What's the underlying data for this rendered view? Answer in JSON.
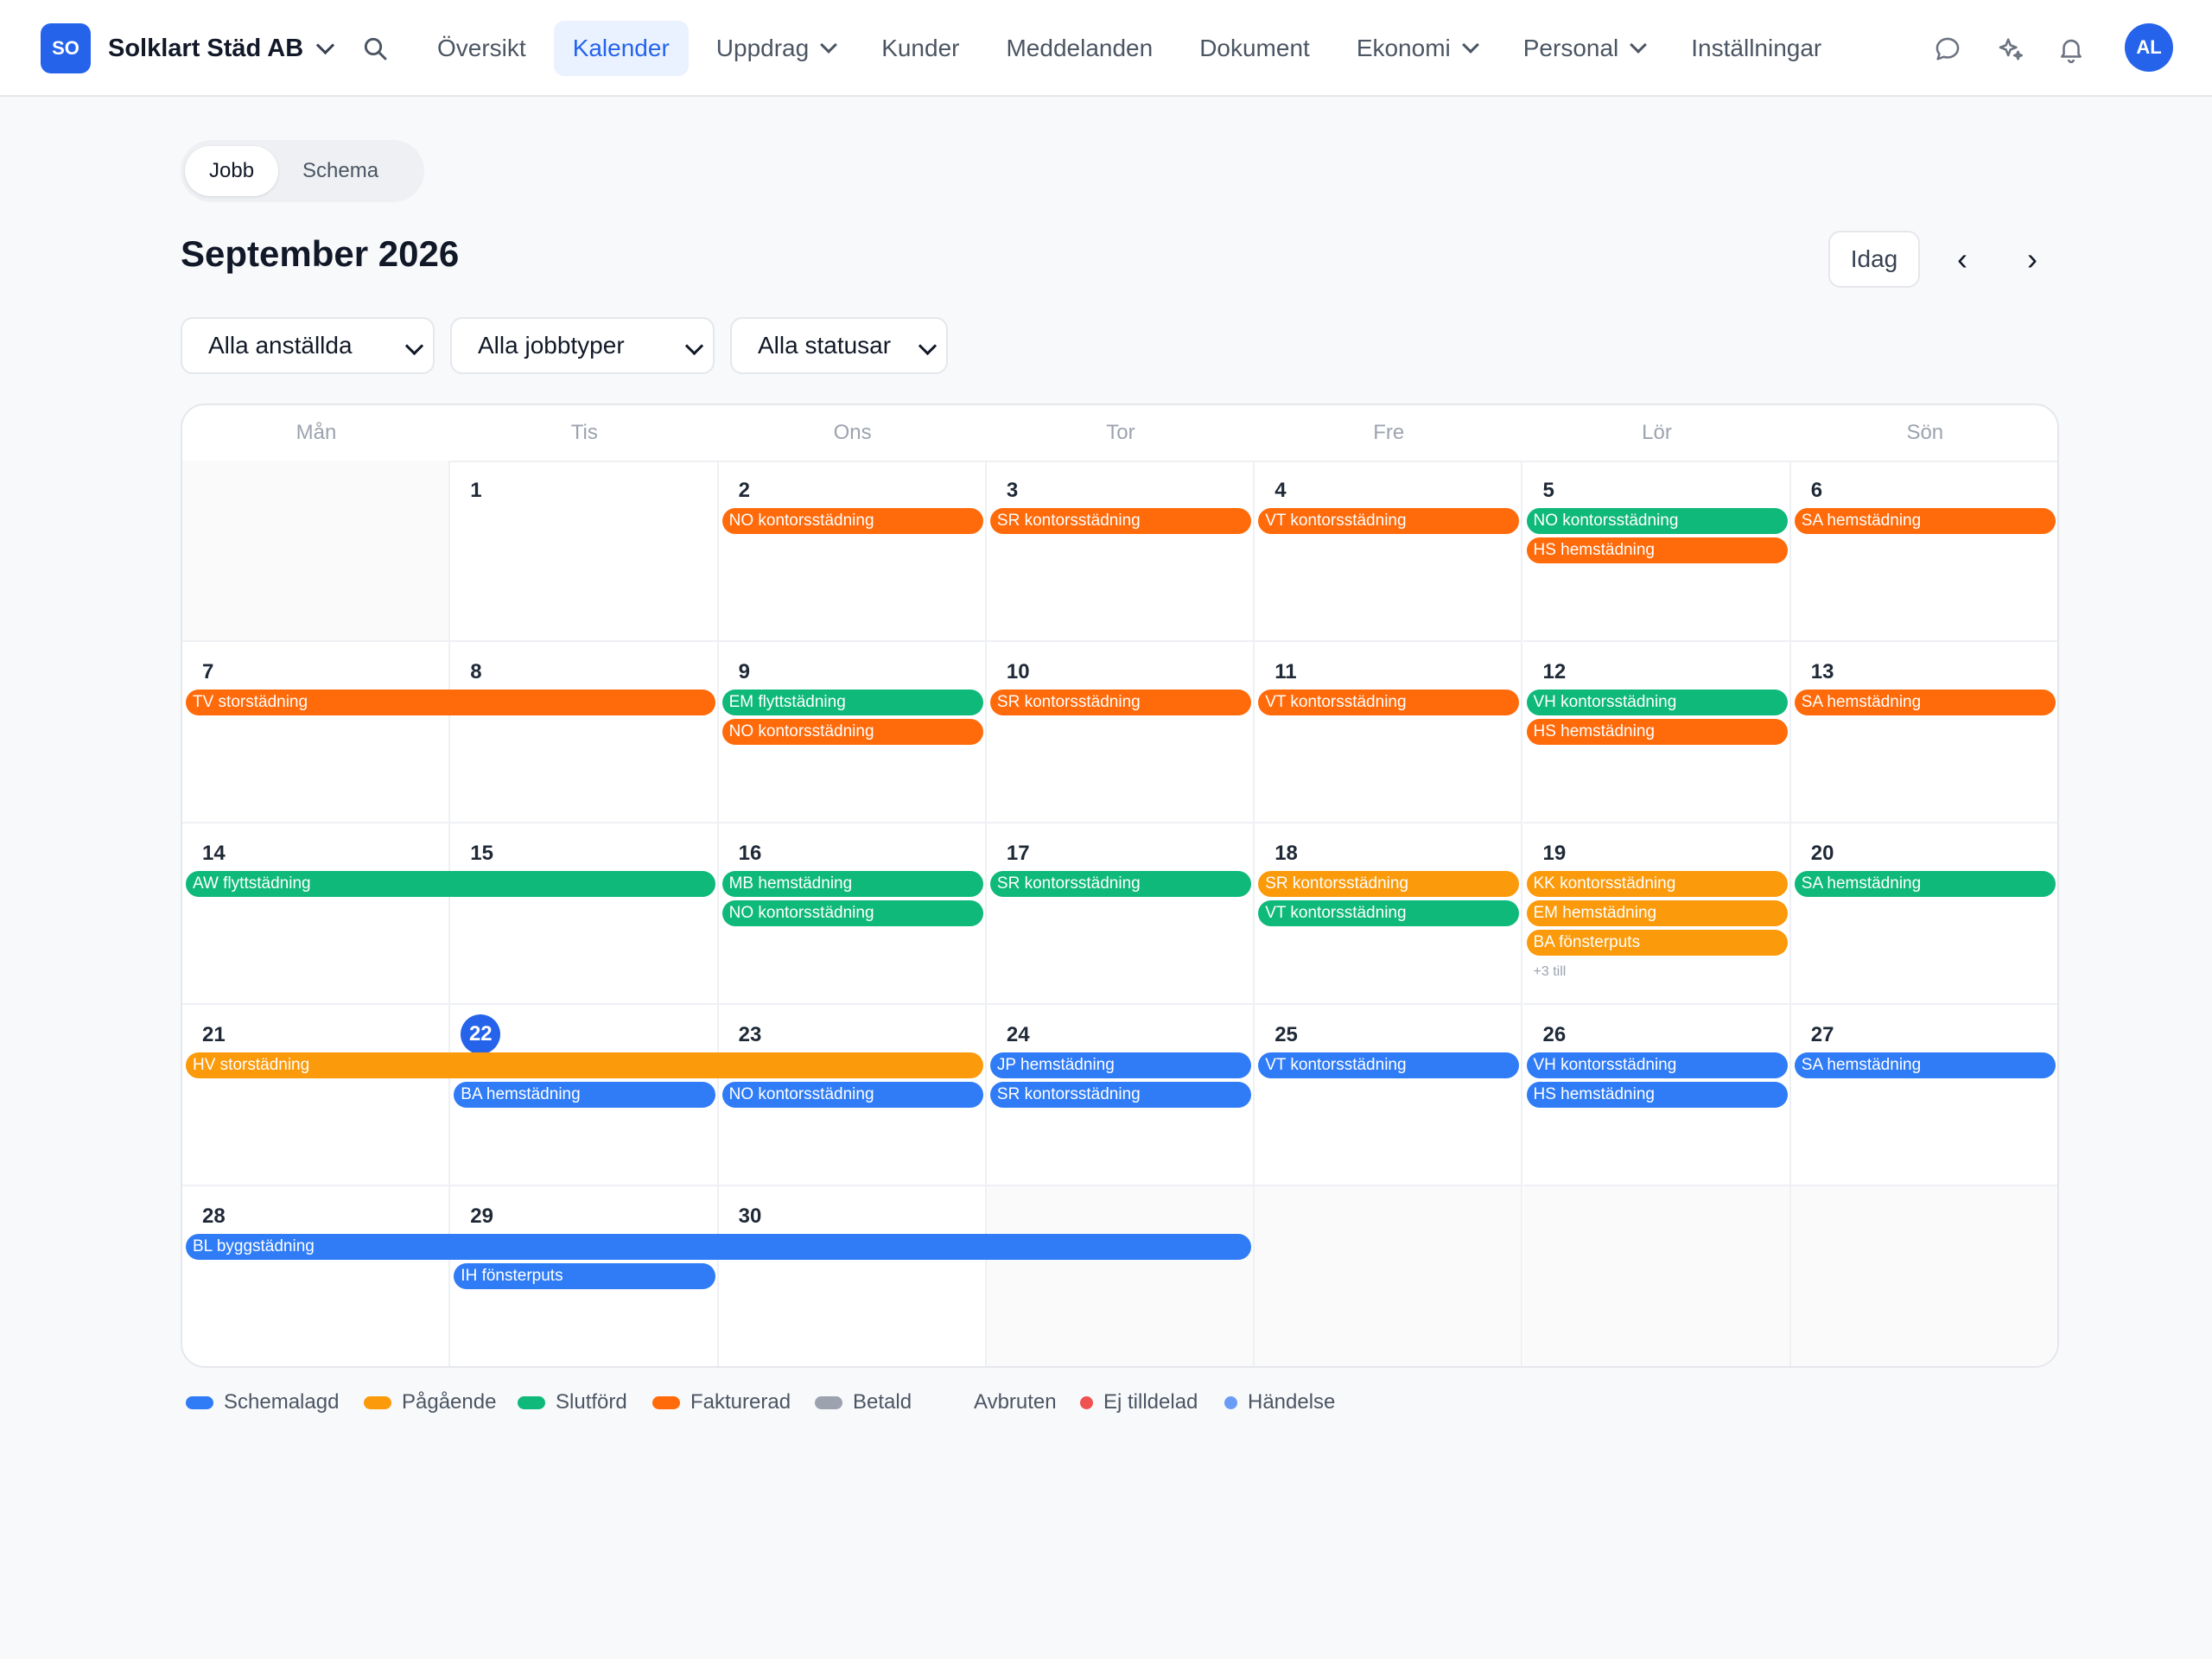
{
  "org": {
    "initials": "SO",
    "name": "Solklart Städ AB"
  },
  "nav": [
    "Översikt",
    "Kalender",
    "Uppdrag",
    "Kunder",
    "Meddelanden",
    "Dokument",
    "Ekonomi",
    "Personal",
    "Inställningar"
  ],
  "nav_active": "Kalender",
  "user": {
    "initials": "AL"
  },
  "view_toggle": [
    "Jobb",
    "Schema"
  ],
  "month_title": "September 2026",
  "today_btn": "Idag",
  "prev_label": "‹",
  "next_label": "›",
  "filters": [
    "Alla anställda",
    "Alla jobbtyper",
    "Alla statusar"
  ],
  "weekdays": [
    "Mån",
    "Tis",
    "Ons",
    "Tor",
    "Fre",
    "Lör",
    "Sön"
  ],
  "today_date": 22,
  "weeks": [
    [
      null,
      1,
      2,
      3,
      4,
      5,
      6
    ],
    [
      7,
      8,
      9,
      10,
      11,
      12,
      13
    ],
    [
      14,
      15,
      16,
      17,
      18,
      19,
      20
    ],
    [
      21,
      22,
      23,
      24,
      25,
      26,
      27
    ],
    [
      28,
      29,
      30,
      null,
      null,
      null,
      null
    ]
  ],
  "colors": {
    "schemalagd": "#2f7cf6",
    "pagaende": "#fb9a0b",
    "slutford": "#0fb97a",
    "fakturerad": "#ff6a0a",
    "betald": "#9ca3af",
    "ej_tilldelad": "#f05252",
    "handelse": "#6b9cf5"
  },
  "events": [
    {
      "week": 0,
      "day": 2,
      "span": 1,
      "lane": 0,
      "label": "NO kontorsstädning",
      "status": "fakturerad"
    },
    {
      "week": 0,
      "day": 3,
      "span": 1,
      "lane": 0,
      "label": "SR kontorsstädning",
      "status": "fakturerad"
    },
    {
      "week": 0,
      "day": 4,
      "span": 1,
      "lane": 0,
      "label": "VT kontorsstädning",
      "status": "fakturerad"
    },
    {
      "week": 0,
      "day": 5,
      "span": 1,
      "lane": 0,
      "label": "NO kontorsstädning",
      "status": "slutford"
    },
    {
      "week": 0,
      "day": 5,
      "span": 1,
      "lane": 1,
      "label": "HS hemstädning",
      "status": "fakturerad"
    },
    {
      "week": 0,
      "day": 6,
      "span": 1,
      "lane": 0,
      "label": "SA hemstädning",
      "status": "fakturerad"
    },
    {
      "week": 1,
      "day": 0,
      "span": 2,
      "lane": 0,
      "label": "TV storstädning",
      "status": "fakturerad"
    },
    {
      "week": 1,
      "day": 2,
      "span": 1,
      "lane": 0,
      "label": "EM flyttstädning",
      "status": "slutford"
    },
    {
      "week": 1,
      "day": 2,
      "span": 1,
      "lane": 1,
      "label": "NO kontorsstädning",
      "status": "fakturerad"
    },
    {
      "week": 1,
      "day": 3,
      "span": 1,
      "lane": 0,
      "label": "SR kontorsstädning",
      "status": "fakturerad"
    },
    {
      "week": 1,
      "day": 4,
      "span": 1,
      "lane": 0,
      "label": "VT kontorsstädning",
      "status": "fakturerad"
    },
    {
      "week": 1,
      "day": 5,
      "span": 1,
      "lane": 0,
      "label": "VH kontorsstädning",
      "status": "slutford"
    },
    {
      "week": 1,
      "day": 5,
      "span": 1,
      "lane": 1,
      "label": "HS hemstädning",
      "status": "fakturerad"
    },
    {
      "week": 1,
      "day": 6,
      "span": 1,
      "lane": 0,
      "label": "SA hemstädning",
      "status": "fakturerad"
    },
    {
      "week": 2,
      "day": 0,
      "span": 2,
      "lane": 0,
      "label": "AW flyttstädning",
      "status": "slutford"
    },
    {
      "week": 2,
      "day": 2,
      "span": 1,
      "lane": 0,
      "label": "MB hemstädning",
      "status": "slutford"
    },
    {
      "week": 2,
      "day": 2,
      "span": 1,
      "lane": 1,
      "label": "NO kontorsstädning",
      "status": "slutford"
    },
    {
      "week": 2,
      "day": 3,
      "span": 1,
      "lane": 0,
      "label": "SR kontorsstädning",
      "status": "slutford"
    },
    {
      "week": 2,
      "day": 4,
      "span": 1,
      "lane": 0,
      "label": "SR kontorsstädning",
      "status": "pagaende"
    },
    {
      "week": 2,
      "day": 4,
      "span": 1,
      "lane": 1,
      "label": "VT kontorsstädning",
      "status": "slutford"
    },
    {
      "week": 2,
      "day": 5,
      "span": 1,
      "lane": 0,
      "label": "KK kontorsstädning",
      "status": "pagaende"
    },
    {
      "week": 2,
      "day": 5,
      "span": 1,
      "lane": 1,
      "label": "EM hemstädning",
      "status": "pagaende"
    },
    {
      "week": 2,
      "day": 5,
      "span": 1,
      "lane": 2,
      "label": "BA fönsterputs",
      "status": "pagaende"
    },
    {
      "week": 2,
      "day": 6,
      "span": 1,
      "lane": 0,
      "label": "SA hemstädning",
      "status": "slutford"
    },
    {
      "week": 3,
      "day": 0,
      "span": 3,
      "lane": 0,
      "label": "HV storstädning",
      "status": "pagaende"
    },
    {
      "week": 3,
      "day": 1,
      "span": 1,
      "lane": 1,
      "label": "BA hemstädning",
      "status": "schemalagd"
    },
    {
      "week": 3,
      "day": 2,
      "span": 1,
      "lane": 1,
      "label": "NO kontorsstädning",
      "status": "schemalagd"
    },
    {
      "week": 3,
      "day": 3,
      "span": 1,
      "lane": 0,
      "label": "JP hemstädning",
      "status": "schemalagd"
    },
    {
      "week": 3,
      "day": 3,
      "span": 1,
      "lane": 1,
      "label": "SR kontorsstädning",
      "status": "schemalagd"
    },
    {
      "week": 3,
      "day": 4,
      "span": 1,
      "lane": 0,
      "label": "VT kontorsstädning",
      "status": "schemalagd"
    },
    {
      "week": 3,
      "day": 5,
      "span": 1,
      "lane": 0,
      "label": "VH kontorsstädning",
      "status": "schemalagd"
    },
    {
      "week": 3,
      "day": 5,
      "span": 1,
      "lane": 1,
      "label": "HS hemstädning",
      "status": "schemalagd"
    },
    {
      "week": 3,
      "day": 6,
      "span": 1,
      "lane": 0,
      "label": "SA hemstädning",
      "status": "schemalagd"
    },
    {
      "week": 4,
      "day": 0,
      "span": 4,
      "lane": 0,
      "label": "BL byggstädning",
      "status": "schemalagd"
    },
    {
      "week": 4,
      "day": 1,
      "span": 1,
      "lane": 1,
      "label": "IH fönsterputs",
      "status": "schemalagd"
    }
  ],
  "more": [
    {
      "week": 2,
      "day": 5,
      "lane": 3,
      "label": "+3 till"
    }
  ],
  "legend": [
    {
      "label": "Schemalagd",
      "status": "schemalagd",
      "shape": "pill"
    },
    {
      "label": "Pågående",
      "status": "pagaende",
      "shape": "pill"
    },
    {
      "label": "Slutförd",
      "status": "slutford",
      "shape": "pill"
    },
    {
      "label": "Fakturerad",
      "status": "fakturerad",
      "shape": "pill"
    },
    {
      "label": "Betald",
      "status": "betald",
      "shape": "pill"
    },
    {
      "label": "Avbruten",
      "status": null,
      "shape": "none"
    },
    {
      "label": "Ej tilldelad",
      "status": "ej_tilldelad",
      "shape": "dot"
    },
    {
      "label": "Händelse",
      "status": "handelse",
      "shape": "dot"
    }
  ]
}
